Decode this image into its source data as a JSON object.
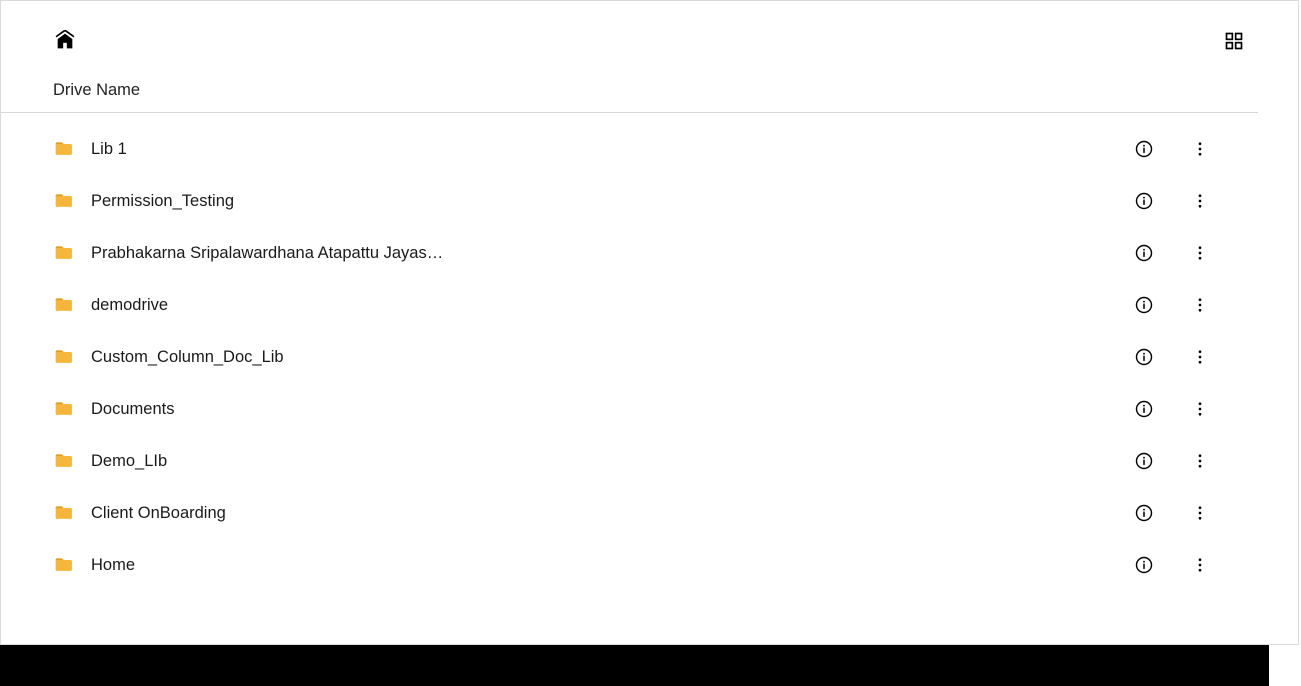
{
  "header": {
    "column_label": "Drive Name"
  },
  "drives": [
    {
      "name": "Lib 1"
    },
    {
      "name": "Permission_Testing"
    },
    {
      "name": "Prabhakarna Sripalawardhana Atapattu Jayasuriya Laxmansriramkrishna"
    },
    {
      "name": "demodrive"
    },
    {
      "name": "Custom_Column_Doc_Lib"
    },
    {
      "name": "Documents"
    },
    {
      "name": "Demo_LIb"
    },
    {
      "name": "Client OnBoarding"
    },
    {
      "name": "Home"
    }
  ]
}
